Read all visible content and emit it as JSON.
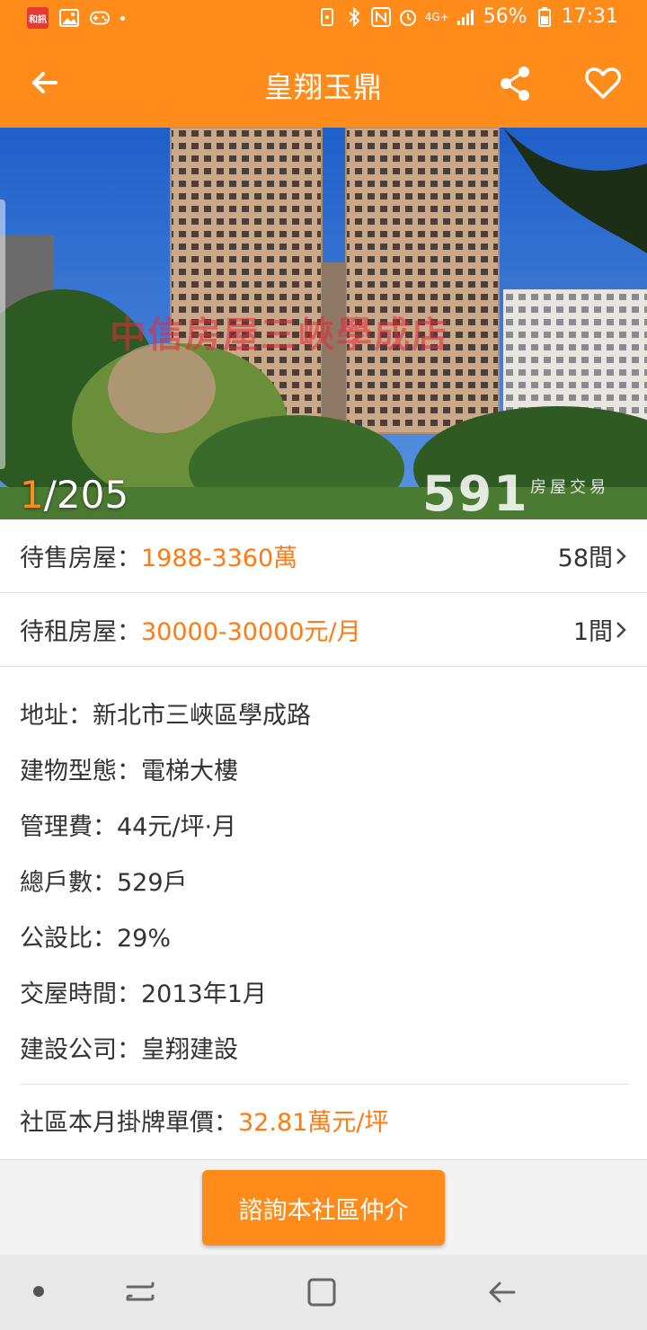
{
  "status_bar": {
    "app_badge": "和訊",
    "battery": "56%",
    "time": "17:31",
    "network": "4G+"
  },
  "app_bar": {
    "title": "皇翔玉鼎",
    "icons": [
      "back-arrow-icon",
      "share-icon",
      "heart-icon"
    ]
  },
  "photo": {
    "current_index": "1",
    "total": "/205",
    "watermark": "591",
    "watermark_sub": "房屋交易",
    "overlay_text": "中信房屋三峽學成店"
  },
  "listings": [
    {
      "label": "待售房屋：",
      "value": "1988-3360萬",
      "count": "58間"
    },
    {
      "label": "待租房屋：",
      "value": "30000-30000元/月",
      "count": "1間"
    }
  ],
  "info": [
    "地址：新北市三峽區學成路",
    "建物型態：電梯大樓",
    "管理費：44元/坪·月",
    "總戶數：529戶",
    "公設比：29%",
    "交屋時間：2013年1月",
    "建設公司：皇翔建設"
  ],
  "monthly_price": {
    "label": "社區本月掛牌單價：",
    "value": "32.81萬元/坪"
  },
  "cta": {
    "label": "諮詢本社區仲介"
  },
  "colors": {
    "accent": "#ff8c1a",
    "value_text": "#ff7a12"
  }
}
